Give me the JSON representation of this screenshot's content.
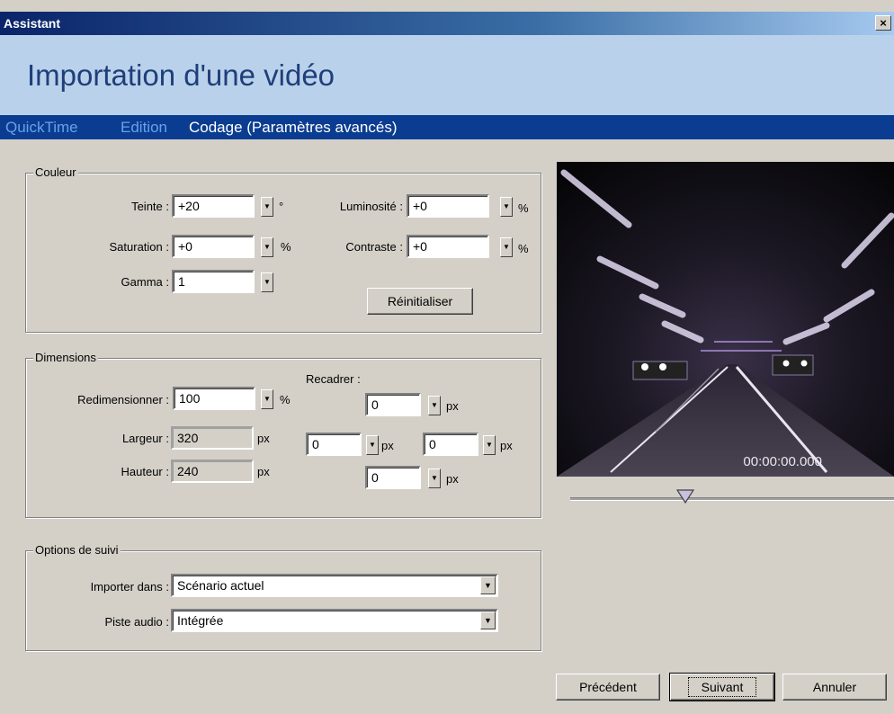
{
  "window": {
    "title": "Assistant",
    "close": "×"
  },
  "header": {
    "title": "Importation d'une vidéo"
  },
  "steps": [
    "QuickTime",
    "Edition",
    "Codage (Paramètres avancés)"
  ],
  "couleur": {
    "legend": "Couleur",
    "teinte": {
      "label": "Teinte :",
      "value": "+20",
      "unit": "°"
    },
    "saturation": {
      "label": "Saturation :",
      "value": "+0",
      "unit": "%"
    },
    "gamma": {
      "label": "Gamma :",
      "value": "1"
    },
    "luminosite": {
      "label": "Luminosité :",
      "value": "+0",
      "unit": "%"
    },
    "contraste": {
      "label": "Contraste :",
      "value": "+0",
      "unit": "%"
    },
    "reset_label": "Réinitialiser"
  },
  "dimensions": {
    "legend": "Dimensions",
    "redim": {
      "label": "Redimensionner :",
      "value": "100",
      "unit": "%"
    },
    "largeur": {
      "label": "Largeur :",
      "value": "320",
      "unit": "px"
    },
    "hauteur": {
      "label": "Hauteur :",
      "value": "240",
      "unit": "px"
    },
    "recadrer": {
      "label": "Recadrer :",
      "top": "0",
      "left": "0",
      "right": "0",
      "bottom": "0",
      "unit": "px"
    }
  },
  "suivi": {
    "legend": "Options de suivi",
    "importer": {
      "label": "Importer dans :",
      "value": "Scénario actuel"
    },
    "piste": {
      "label": "Piste audio :",
      "value": "Intégrée"
    }
  },
  "preview": {
    "timecode": "00:00:00.000"
  },
  "buttons": {
    "prev": "Précédent",
    "next": "Suivant",
    "cancel": "Annuler"
  },
  "icons": {
    "spin": "spin-down-icon",
    "dropdown": "chevron-down-icon",
    "seek": "seek-thumb-icon"
  }
}
